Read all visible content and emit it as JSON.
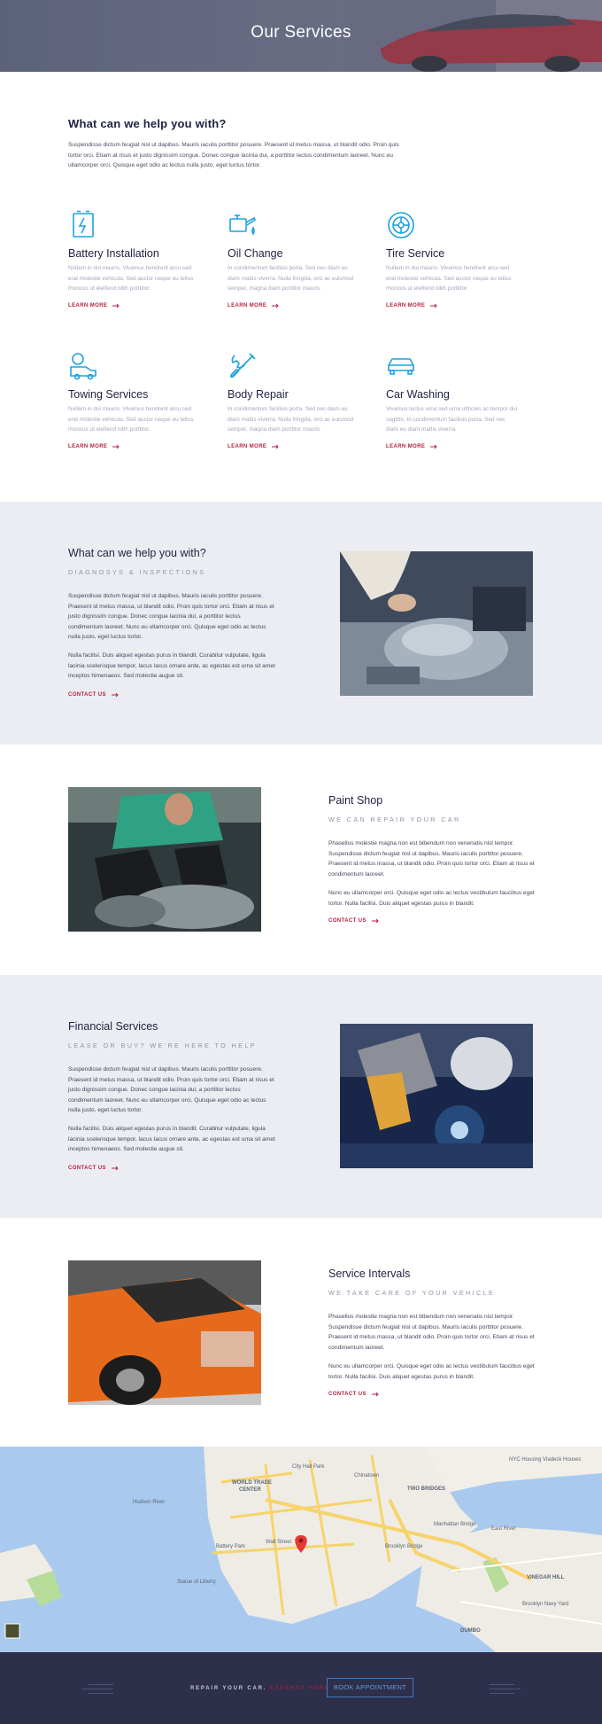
{
  "hero": {
    "title": "Our Services"
  },
  "intro": {
    "heading": "What can we help you with?",
    "text": "Suspendisse dictum feugiat nisl ut dapibus. Mauris iaculis porttitor posuere. Praesent id metus massa, ut blandit odio. Proin quis tortor orci. Etiam at risus et justo dignissim congue. Donec congue lacinia dui, a porttitor lectus condimentum laoreet. Nunc eu ullamcorper orci. Quisque eget odio ac lectus nulla justo, eget luctus tortor."
  },
  "services": [
    {
      "title": "Battery Installation",
      "text": "Nullam in dui mauris. Vivamus hendrerit arcu sed erat molestie vehicula. Sed auctor neque eu tellus rhoncus ut eleifend nibh porttitor.",
      "link": "LEARN MORE",
      "icon": "battery-icon"
    },
    {
      "title": "Oil Change",
      "text": "In condimentum facilisis porta. Sed nec diam eu diam mattis viverra. Nulla fringilla, orci ac euismod semper, magna diam porttitor mauris.",
      "link": "LEARN MORE",
      "icon": "oil-can-icon"
    },
    {
      "title": "Tire Service",
      "text": "Nullam in dui mauris. Vivamus hendrerit arcu sed erat molestie vehicula. Sed auctor neque eu tellus rhoncus ut eleifend nibh porttitor.",
      "link": "LEARN MORE",
      "icon": "tire-icon"
    },
    {
      "title": "Towing Services",
      "text": "Nullam in dui mauris. Vivamus hendrerit arcu sed erat molestie vehicula. Sed auctor neque eu tellus rhoncus ut eleifend nibh porttitor.",
      "link": "LEARN MORE",
      "icon": "tow-truck-icon"
    },
    {
      "title": "Body Repair",
      "text": "In condimentum facilisis porta. Sed nec diam eu diam mattis viverra. Nulla fringilla, orci ac euismod semper, magna diam porttitor mauris.",
      "link": "LEARN MORE",
      "icon": "wrench-icon"
    },
    {
      "title": "Car Washing",
      "text": "Vivamus luctus urna sed urna ultricies ac tempor dui sagittis. In condimentum facilisis porta. Sed nec diam eu diam mattis viverra.",
      "link": "LEARN MORE",
      "icon": "car-icon"
    }
  ],
  "features": [
    {
      "title": "What can we help you with?",
      "subtitle": "DIAGNOSYS & INSPECTIONS",
      "p1": "Suspendisse dictum feugiat nisl ut dapibus. Mauris iaculis porttitor posuere. Praesent id metus massa, ut blandit odio. Proin quis tortor orci. Etiam at risus et justo dignissim congue. Donec congue lacinia dui, a porttitor lectus condimentum laoreet. Nunc eu ullamcorper orci. Quisque eget odio ac lectus nulla justo, eget luctus tortor.",
      "p2": "Nulla facilisi. Duis aliquet egestas purus in blandit. Curabitur vulputate, ligula lacinia scelerisque tempor, lacus lacus ornare ante, ac egestas est urna sit amet inceptos himenaeos. Sed molestie augue sit.",
      "link": "CONTACT US"
    },
    {
      "title": "Paint Shop",
      "subtitle": "WE CAN REPAIR YOUR CAR",
      "p1": "Phasellus molestie magna non est bibendum non venenatis nisl tempor. Suspendisse dictum feugiat nisl ut dapibus. Mauris iaculis porttitor posuere. Praesent id metus massa, ut blandit odio. Proin quis tortor orci. Etiam at risus et condimentum laoreet.",
      "p2": "Nunc eu ullamcorper orci. Quisque eget odio ac lectus vestibulum faucibus eget tortor. Nulla facilisi. Duis aliquet egestas purus in blandit.",
      "link": "CONTACT US"
    },
    {
      "title": "Financial Services",
      "subtitle": "LEASE OR BUY? WE'RE HERE TO HELP",
      "p1": "Suspendisse dictum feugiat nisl ut dapibus. Mauris iaculis porttitor posuere. Praesent id metus massa, ut blandit odio. Proin quis tortor orci. Etiam at risus et justo dignissim congue. Donec congue lacinia dui, a porttitor lectus condimentum laoreet. Nunc eu ullamcorper orci. Quisque eget odio ac lectus nulla justo, eget luctus tortor.",
      "p2": "Nulla facilisi. Duis aliquet egestas purus in blandit. Curabitur vulputate, ligula lacinia scelerisque tempor, lacus lacus ornare ante, ac egestas est urna sit amet inceptos himenaeos. Sed molestie augue sit.",
      "link": "CONTACT US"
    },
    {
      "title": "Service Intervals",
      "subtitle": "WE TAKE CARE OF YOUR VEHICLE",
      "p1": "Phasellus molestie magna non est bibendum non venenatis nisl tempor. Suspendisse dictum feugiat nisl ut dapibus. Mauris iaculis porttitor posuere. Praesent id metus massa, ut blandit odio. Proin quis tortor orci. Etiam at risus et condimentum laoreet.",
      "p2": "Nunc eu ullamcorper orci. Quisque eget odio ac lectus vestibulum faucibus eget tortor. Nulla facilisi. Duis aliquet egestas purus in blandit.",
      "link": "CONTACT US"
    }
  ],
  "map": {
    "labels": [
      "WORLD TRADE",
      "CENTER",
      "TWO BRIDGES",
      "DUMBO",
      "VINEGAR HILL",
      "Battery Park",
      "Wall Street",
      "Brooklyn Bridge",
      "East River",
      "NYC Housing Vladeck Houses",
      "Manhattan Bridge",
      "Brooklyn Navy Yard",
      "City Hall Park",
      "Chinatown",
      "Hudson River",
      "Statue of Liberty"
    ]
  },
  "footer": {
    "text": "REPAIR YOUR CAR.",
    "highlight": "EXPERTS HERE",
    "button": "BOOK APPOINTMENT"
  },
  "colors": {
    "accent": "#b41f3e",
    "icon": "#1ea2e0",
    "footer": "#2e2f4a",
    "band": "#ecedf2"
  }
}
